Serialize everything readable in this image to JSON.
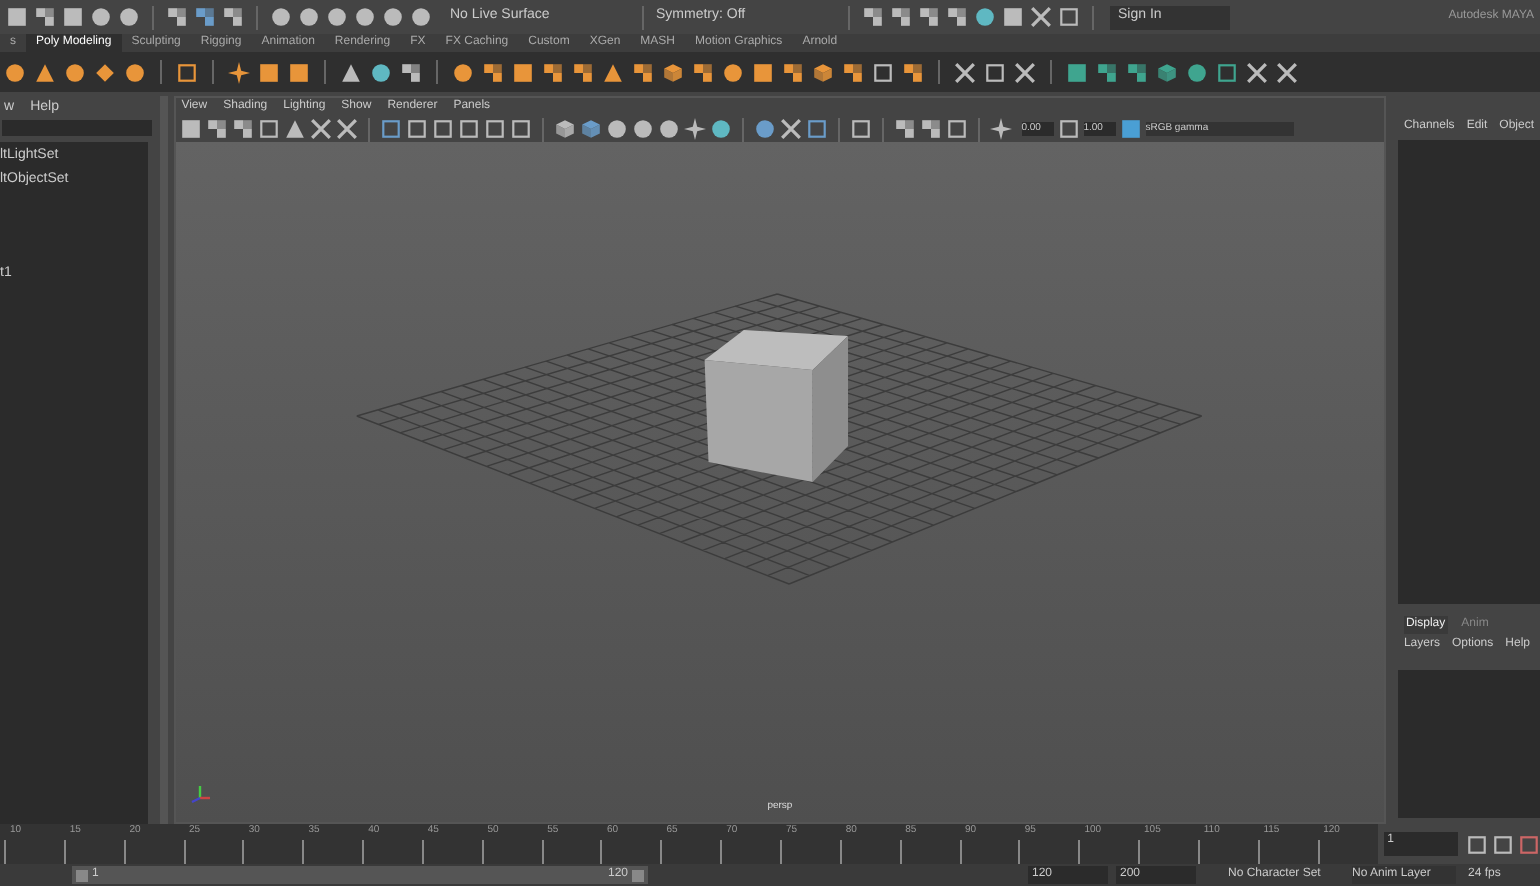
{
  "status_line": {
    "live_surface": "No Live Surface",
    "symmetry": "Symmetry: Off",
    "sign_in": "Sign In",
    "product": "Autodesk MAYA"
  },
  "shelf_tabs": [
    {
      "label": "s",
      "selected": false
    },
    {
      "label": "Poly Modeling",
      "selected": true
    },
    {
      "label": "Sculpting",
      "selected": false
    },
    {
      "label": "Rigging",
      "selected": false
    },
    {
      "label": "Animation",
      "selected": false
    },
    {
      "label": "Rendering",
      "selected": false
    },
    {
      "label": "FX",
      "selected": false
    },
    {
      "label": "FX Caching",
      "selected": false
    },
    {
      "label": "Custom",
      "selected": false
    },
    {
      "label": "XGen",
      "selected": false
    },
    {
      "label": "MASH",
      "selected": false
    },
    {
      "label": "Motion Graphics",
      "selected": false
    },
    {
      "label": "Arnold",
      "selected": false
    }
  ],
  "outliner": {
    "menu": [
      "w",
      "Help"
    ],
    "items": [
      {
        "label": "ltLightSet"
      },
      {
        "label": "ltObjectSet"
      },
      {
        "label": "t1"
      }
    ]
  },
  "viewport": {
    "menu": [
      "View",
      "Shading",
      "Lighting",
      "Show",
      "Renderer",
      "Panels"
    ],
    "exposure": "0.00",
    "gamma": "1.00",
    "color_space": "sRGB gamma",
    "camera": "persp"
  },
  "channel_box": {
    "menu": [
      "Channels",
      "Edit",
      "Object"
    ]
  },
  "layer_editor": {
    "tabs": [
      {
        "label": "Display",
        "selected": true
      },
      {
        "label": "Anim",
        "selected": false
      }
    ],
    "menu": [
      "Layers",
      "Options",
      "Help"
    ]
  },
  "time_slider": {
    "ticks": [
      "10",
      "15",
      "20",
      "25",
      "30",
      "35",
      "40",
      "45",
      "50",
      "55",
      "60",
      "65",
      "70",
      "75",
      "80",
      "85",
      "90",
      "95",
      "100",
      "105",
      "110",
      "115",
      "120"
    ],
    "current_frame": "1"
  },
  "range_slider": {
    "range_start": "1",
    "range_end": "120",
    "end_field": "120",
    "max_field": "200",
    "character_set": "No Character Set",
    "anim_layer": "No Anim Layer",
    "fps": "24 fps"
  }
}
